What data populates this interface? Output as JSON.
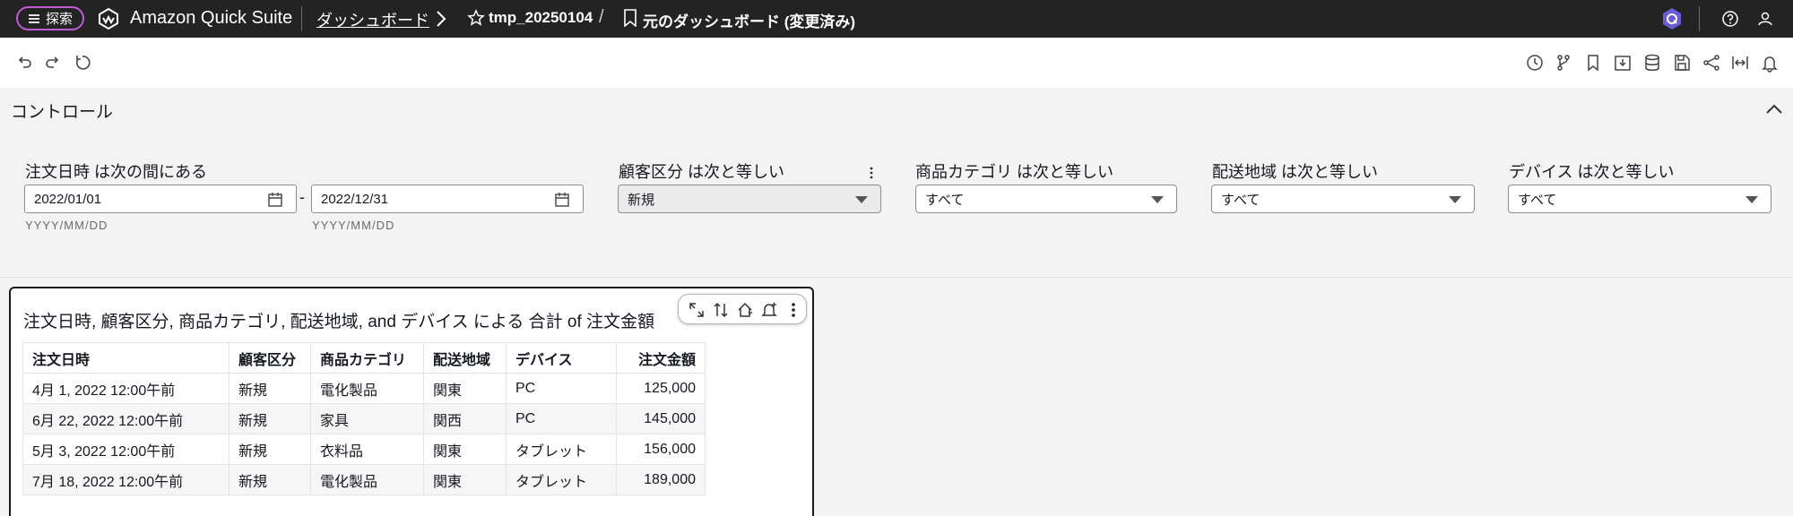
{
  "topbar": {
    "explore_label": "探索",
    "brand": "Amazon Quick Suite",
    "dashboards_link": "ダッシュボード",
    "analysis_name": "tmp_20250104",
    "separator": "/",
    "dashboard_name": "元のダッシュボード (変更済み)",
    "icons": [
      "menu-icon",
      "quicksuite-logo",
      "chevron-right-icon",
      "star-icon",
      "bookmark-icon",
      "q-assistant-icon",
      "help-icon",
      "user-icon"
    ]
  },
  "toolbar": {
    "left_icons": [
      "undo-icon",
      "redo-icon",
      "reset-icon"
    ],
    "right_icons": [
      "history-icon",
      "branch-icon",
      "bookmark-icon",
      "export-icon",
      "dataset-icon",
      "save-icon",
      "share-icon",
      "fit-width-icon",
      "alert-icon"
    ]
  },
  "controls": {
    "title": "コントロール",
    "date_filter": {
      "label": "注文日時 は次の間にある",
      "start": "2022/01/01",
      "end": "2022/12/31",
      "dash": "-",
      "format_hint": "YYYY/MM/DD"
    },
    "customer_segment": {
      "label": "顧客区分 は次と等しい",
      "value": "新規"
    },
    "product_category": {
      "label": "商品カテゴリ は次と等しい",
      "value": "すべて"
    },
    "region": {
      "label": "配送地域 は次と等しい",
      "value": "すべて"
    },
    "device": {
      "label": "デバイス は次と等しい",
      "value": "すべて"
    }
  },
  "visual": {
    "title": "注文日時, 顧客区分, 商品カテゴリ, 配送地域, and デバイス による 合計 of 注文金額",
    "columns": [
      "注文日時",
      "顧客区分",
      "商品カテゴリ",
      "配送地域",
      "デバイス",
      "注文金額"
    ],
    "rows": [
      [
        "4月 1, 2022 12:00午前",
        "新規",
        "電化製品",
        "関東",
        "PC",
        "125,000"
      ],
      [
        "6月 22, 2022 12:00午前",
        "新規",
        "家具",
        "関西",
        "PC",
        "145,000"
      ],
      [
        "5月 3, 2022 12:00午前",
        "新規",
        "衣料品",
        "関東",
        "タブレット",
        "156,000"
      ],
      [
        "7月 18, 2022 12:00午前",
        "新規",
        "電化製品",
        "関東",
        "タブレット",
        "189,000"
      ]
    ],
    "tool_icons": [
      "expand-icon",
      "sort-icon",
      "drill-up-icon",
      "alert-icon",
      "more-options-icon"
    ]
  },
  "colors": {
    "topbar_bg": "#232323",
    "explore_border": "#c05bd8",
    "q_icon": "#6b5bd8"
  }
}
